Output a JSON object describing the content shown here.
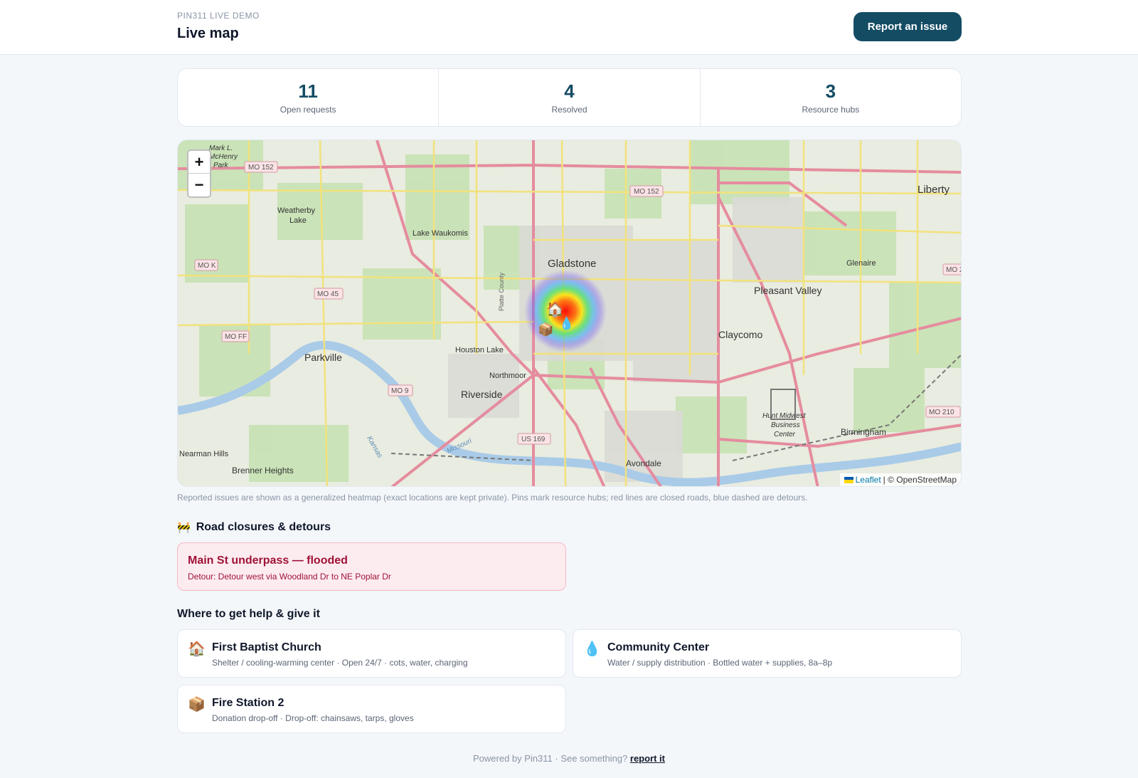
{
  "header": {
    "kicker": "PIN311 LIVE DEMO",
    "title": "Live map",
    "report_button": "Report an issue"
  },
  "stats": [
    {
      "value": "11",
      "label": "Open requests"
    },
    {
      "value": "4",
      "label": "Resolved"
    },
    {
      "value": "3",
      "label": "Resource hubs"
    }
  ],
  "map": {
    "zoom_in": "+",
    "zoom_out": "−",
    "attribution_leaflet": "Leaflet",
    "attribution_sep": "| © OpenStreetMap",
    "labels": {
      "gladstone": "Gladstone",
      "parkville": "Parkville",
      "riverside": "Riverside",
      "liberty": "Liberty",
      "pleasant_valley": "Pleasant Valley",
      "claycomo": "Claycomo",
      "glenaire": "Glenaire",
      "birmingham": "Birmingham",
      "avondale": "Avondale",
      "northmoor": "Northmoor",
      "houston_lake": "Houston Lake",
      "lake_waukomis": "Lake Waukomis",
      "weatherby_lake_1": "Weatherby",
      "weatherby_lake_2": "Lake",
      "nearman_hills": "Nearman Hills",
      "brenner_heights": "Brenner Heights",
      "hunt_midwest_1": "Hunt Midwest",
      "hunt_midwest_2": "Business",
      "hunt_midwest_3": "Center",
      "mckenry_1": "Mark L.",
      "mckenry_2": "McHenry",
      "mckenry_3": "Park",
      "platte_county": "Platte County",
      "missouri": "Missouri",
      "kansas": "Kansas"
    },
    "shields": [
      "MO 152",
      "MO 152",
      "MO K",
      "MO 45",
      "MO FF",
      "MO 9",
      "US 169",
      "MO 210",
      "MO 2"
    ]
  },
  "map_note": "Reported issues are shown as a generalized heatmap (exact locations are kept private). Pins mark resource hubs; red lines are closed roads, blue dashed are detours.",
  "closures": {
    "title": "Road closures & detours",
    "icon": "construction-barrier-icon",
    "items": [
      {
        "title": "Main St underpass — flooded",
        "detour": "Detour: Detour west via Woodland Dr to NE Poplar Dr"
      }
    ]
  },
  "help": {
    "title": "Where to get help & give it",
    "hubs": [
      {
        "icon": "🏠",
        "icon_name": "house-icon",
        "name": "First Baptist Church",
        "desc": "Shelter / cooling-warming center · Open 24/7 · cots, water, charging"
      },
      {
        "icon": "💧",
        "icon_name": "water-drop-icon",
        "name": "Community Center",
        "desc": "Water / supply distribution · Bottled water + supplies, 8a–8p"
      },
      {
        "icon": "📦",
        "icon_name": "package-icon",
        "name": "Fire Station 2",
        "desc": "Donation drop-off · Drop-off: chainsaws, tarps, gloves"
      }
    ]
  },
  "footer": {
    "text": "Powered by Pin311 · See something?",
    "link": "report it"
  },
  "colors": {
    "brand": "#144c64",
    "closure_bg": "#fdecef",
    "closure_text": "#9f1239"
  }
}
